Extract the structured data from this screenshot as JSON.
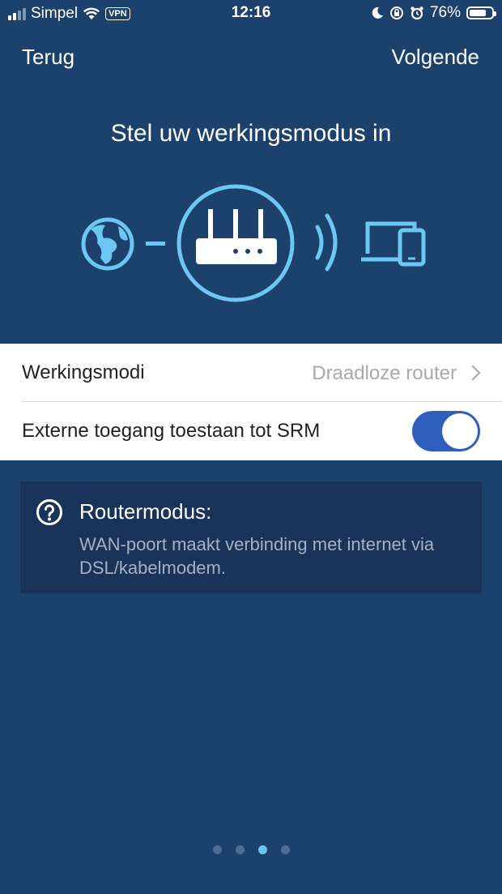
{
  "status_bar": {
    "carrier": "Simpel",
    "vpn": "VPN",
    "time": "12:16",
    "battery_percent": "76%",
    "battery_level": 0.76,
    "icons": [
      "signal-icon",
      "wifi-icon",
      "moon-icon",
      "rotation-lock-icon",
      "alarm-icon",
      "battery-icon"
    ]
  },
  "nav": {
    "back_label": "Terug",
    "next_label": "Volgende"
  },
  "page": {
    "title": "Stel uw werkingsmodus in"
  },
  "illustration": {
    "icons": [
      "globe-icon",
      "router-icon",
      "wireless-waves-icon",
      "devices-icon"
    ],
    "accent_color": "#6cc8f2"
  },
  "settings": {
    "mode_label": "Werkingsmodi",
    "mode_value": "Draadloze router",
    "external_access_label": "Externe toegang toestaan tot SRM",
    "external_access_enabled": true
  },
  "info": {
    "title": "Routermodus:",
    "description": "WAN-poort maakt verbinding met internet via DSL/kabelmodem."
  },
  "pagination": {
    "total": 4,
    "active_index": 2
  },
  "colors": {
    "background": "#1b416c",
    "info_box": "#1a3359",
    "toggle_on": "#2e5fbf",
    "active_dot": "#67c6f2"
  }
}
